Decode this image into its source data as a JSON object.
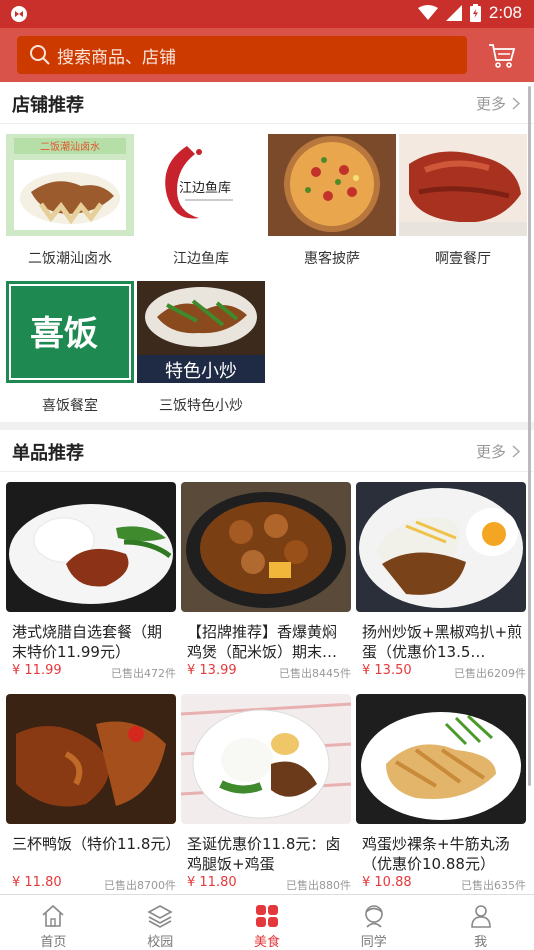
{
  "status": {
    "time": "2:08"
  },
  "search": {
    "placeholder": "搜索商品、店铺"
  },
  "stores_section": {
    "title": "店铺推荐",
    "more": "更多",
    "stores": [
      {
        "name": "二饭潮汕卤水",
        "sign": "二饭潮汕卤水"
      },
      {
        "name": "江边鱼库",
        "sign": "江边鱼库"
      },
      {
        "name": "惠客披萨"
      },
      {
        "name": "啊壹餐厅"
      },
      {
        "name": "喜饭餐室",
        "sign": "喜饭"
      },
      {
        "name": "三饭特色小炒",
        "sign": "特色小炒"
      }
    ]
  },
  "products_section": {
    "title": "单品推荐",
    "more": "更多",
    "products": [
      {
        "name": "港式烧腊自选套餐（期末特价11.99元）",
        "price": "¥ 11.99",
        "sold": "已售出472件"
      },
      {
        "name": "【招牌推荐】香爆黄焖鸡煲（配米饭）期末…",
        "price": "¥ 13.99",
        "sold": "已售出8445件"
      },
      {
        "name": "扬州炒饭+黑椒鸡扒+煎蛋（优惠价13.5…",
        "price": "¥ 13.50",
        "sold": "已售出6209件"
      },
      {
        "name": "三杯鸭饭（特价11.8元）",
        "price": "¥ 11.80",
        "sold": "已售出8700件"
      },
      {
        "name": "圣诞优惠价11.8元：卤鸡腿饭+鸡蛋",
        "price": "¥ 11.80",
        "sold": "已售出880件"
      },
      {
        "name": "鸡蛋炒裸条+牛筋丸汤（优惠价10.88元）",
        "price": "¥ 10.88",
        "sold": "已售出635件"
      }
    ]
  },
  "tabbar": {
    "tabs": [
      {
        "label": "首页",
        "icon": "home-icon"
      },
      {
        "label": "校园",
        "icon": "layers-icon"
      },
      {
        "label": "美食",
        "icon": "food-grid-icon",
        "active": true
      },
      {
        "label": "同学",
        "icon": "classmate-icon"
      },
      {
        "label": "我",
        "icon": "user-icon"
      }
    ]
  },
  "colors": {
    "accent": "#e4393c",
    "topbar": "#d9534a",
    "search_bg": "#cc3a00"
  }
}
